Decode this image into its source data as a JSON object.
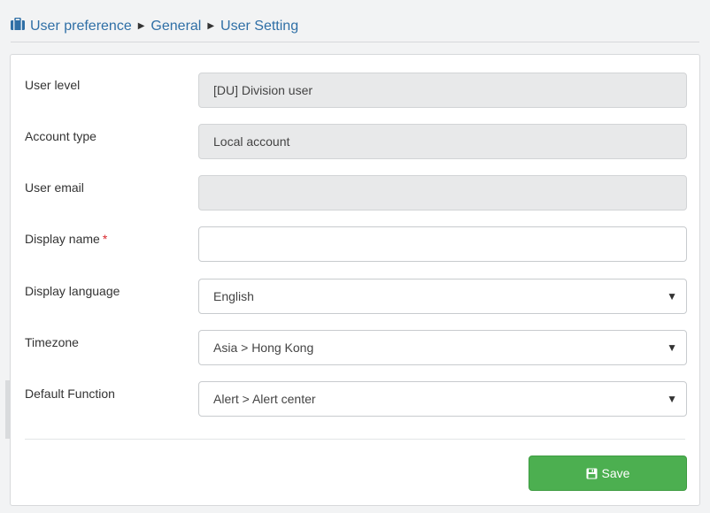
{
  "breadcrumb": {
    "items": [
      "User preference",
      "General",
      "User Setting"
    ]
  },
  "form": {
    "user_level": {
      "label": "User level",
      "value": "[DU] Division user"
    },
    "account_type": {
      "label": "Account type",
      "value": "Local account"
    },
    "user_email": {
      "label": "User email",
      "value": ""
    },
    "display_name": {
      "label": "Display name",
      "required_mark": "*",
      "value": ""
    },
    "display_language": {
      "label": "Display language",
      "value": "English"
    },
    "timezone": {
      "label": "Timezone",
      "value": "Asia > Hong Kong"
    },
    "default_function": {
      "label": "Default Function",
      "value": "Alert > Alert center"
    }
  },
  "actions": {
    "save_label": "Save"
  },
  "colors": {
    "breadcrumb_link": "#2f6fa6",
    "save_button": "#4caf50",
    "required": "#d9282d"
  },
  "icons": {
    "breadcrumb": "briefcase-icon",
    "select_caret": "caret-down-icon",
    "save": "floppy-disk-icon"
  }
}
